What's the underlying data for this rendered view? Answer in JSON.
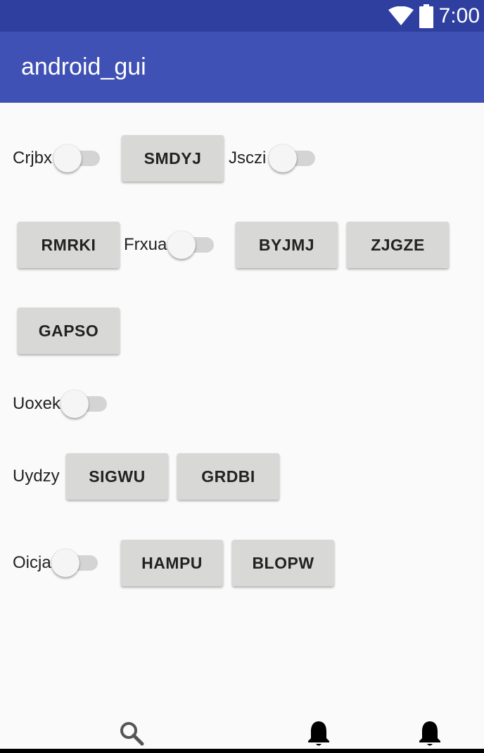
{
  "status_bar": {
    "time": "7:00",
    "icons": [
      "wifi-icon",
      "battery-icon"
    ]
  },
  "app_bar": {
    "title": "android_gui",
    "color": "#3f51b5"
  },
  "rows": {
    "r1": {
      "switch1_label": "Crjbx",
      "button1": "SMDYJ",
      "switch2_label": "Jsczi"
    },
    "r2": {
      "button1": "RMRKI",
      "switch_label": "Frxua",
      "button2": "BYJMJ",
      "button3": "ZJGZE"
    },
    "r3": {
      "button1": "GAPSO"
    },
    "r4": {
      "switch_label": "Uoxek"
    },
    "r5": {
      "label": "Uydzy",
      "button1": "SIGWU",
      "button2": "GRDBI"
    },
    "r6": {
      "switch_label": "Oicja",
      "button1": "HAMPU",
      "button2": "BLOPW"
    }
  },
  "bottom_nav": {
    "icons": [
      "search-icon",
      "bell-icon",
      "bell-icon"
    ]
  }
}
